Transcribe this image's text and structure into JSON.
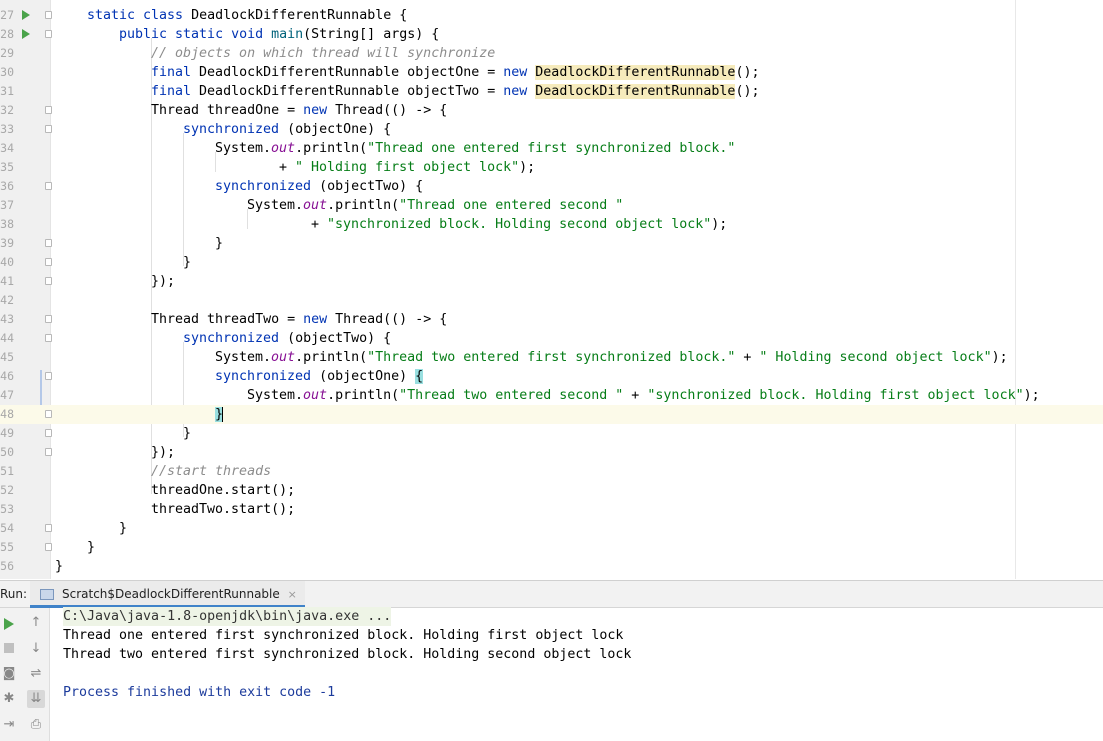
{
  "editor": {
    "lines": [
      {
        "n": "27",
        "run": true,
        "fold": true
      },
      {
        "n": "28",
        "run": true,
        "fold": true
      },
      {
        "n": "29"
      },
      {
        "n": "30"
      },
      {
        "n": "31"
      },
      {
        "n": "32",
        "fold": true
      },
      {
        "n": "33",
        "fold": true
      },
      {
        "n": "34"
      },
      {
        "n": "35"
      },
      {
        "n": "36",
        "fold": true
      },
      {
        "n": "37"
      },
      {
        "n": "38"
      },
      {
        "n": "39",
        "fold": true
      },
      {
        "n": "40",
        "fold": true
      },
      {
        "n": "41",
        "fold": true
      },
      {
        "n": "42"
      },
      {
        "n": "43",
        "fold": true
      },
      {
        "n": "44",
        "fold": true
      },
      {
        "n": "45"
      },
      {
        "n": "46",
        "fold": true
      },
      {
        "n": "47"
      },
      {
        "n": "48",
        "fold": true
      },
      {
        "n": "49",
        "fold": true
      },
      {
        "n": "50",
        "fold": true
      },
      {
        "n": "51"
      },
      {
        "n": "52"
      },
      {
        "n": "53"
      },
      {
        "n": "54",
        "fold": true
      },
      {
        "n": "55",
        "fold": true
      },
      {
        "n": "56"
      }
    ],
    "code": {
      "l27_kw": "static class ",
      "l27_rest": "DeadlockDifferentRunnable {",
      "l28_kw": "public static void ",
      "l28_fn": "main",
      "l28_rest": "(String[] args) {",
      "l29_comment": "// objects on which thread will synchronize",
      "l30_kw": "final ",
      "l30_a": "DeadlockDifferentRunnable objectOne = ",
      "l30_new": "new ",
      "l30_cls": "DeadlockDifferentRunnable",
      "l30_end": "();",
      "l31_kw": "final ",
      "l31_a": "DeadlockDifferentRunnable objectTwo = ",
      "l31_new": "new ",
      "l31_cls": "DeadlockDifferentRunnable",
      "l31_end": "();",
      "l32_a": "Thread threadOne = ",
      "l32_new": "new ",
      "l32_b": "Thread(() -> {",
      "l33_kw": "synchronized ",
      "l33_b": "(objectOne) {",
      "l34_a": "System.",
      "l34_out": "out",
      "l34_b": ".println(",
      "l34_str": "\"Thread one entered first synchronized block.\"",
      "l35_a": "+ ",
      "l35_str": "\" Holding first object lock\"",
      "l35_b": ");",
      "l36_kw": "synchronized ",
      "l36_b": "(objectTwo) {",
      "l37_a": "System.",
      "l37_out": "out",
      "l37_b": ".println(",
      "l37_str": "\"Thread one entered second \"",
      "l38_a": "+ ",
      "l38_str": "\"synchronized block. Holding second object lock\"",
      "l38_b": ");",
      "l39": "}",
      "l40": "}",
      "l41": "});",
      "l43_a": "Thread threadTwo = ",
      "l43_new": "new ",
      "l43_b": "Thread(() -> {",
      "l44_kw": "synchronized ",
      "l44_b": "(objectTwo) {",
      "l45_a": "System.",
      "l45_out": "out",
      "l45_b": ".println(",
      "l45_str1": "\"Thread two entered first synchronized block.\"",
      "l45_c": " + ",
      "l45_str2": "\" Holding second object lock\"",
      "l45_d": ");",
      "l46_kw": "synchronized ",
      "l46_b": "(objectOne) ",
      "l46_brace": "{",
      "l47_a": "System.",
      "l47_out": "out",
      "l47_b": ".println(",
      "l47_str1": "\"Thread two entered second \"",
      "l47_c": " + ",
      "l47_str2": "\"synchronized block. Holding first object lock\"",
      "l47_d": ");",
      "l48_brace": "}",
      "l49": "}",
      "l50": "});",
      "l51_comment": "//start threads",
      "l52": "threadOne.start();",
      "l53": "threadTwo.start();",
      "l54": "}",
      "l55": "}",
      "l56": "}"
    }
  },
  "run_panel": {
    "label": "Run:",
    "tab_label": "Scratch$DeadlockDifferentRunnable",
    "tab_close": "×",
    "output": {
      "command": "C:\\Java\\java-1.8-openjdk\\bin\\java.exe ...",
      "line1": "Thread one entered first synchronized block. Holding first object lock",
      "line2": "Thread two entered first synchronized block. Holding second object lock",
      "exit": "Process finished with exit code -1"
    },
    "tools": {
      "up_icon": "↑",
      "down_icon": "↓",
      "wrap_icon": "⇌",
      "scroll_end_icon": "⇊",
      "print_icon": "⎙",
      "camera_icon": "◙",
      "gear_icon": "✱",
      "exit_icon": "⇥"
    }
  },
  "colors": {
    "keyword": "#0033b3",
    "string": "#067d17",
    "comment": "#8c8c8c",
    "static_field": "#871094",
    "method": "#00627a",
    "current_line": "#fcfae9"
  }
}
